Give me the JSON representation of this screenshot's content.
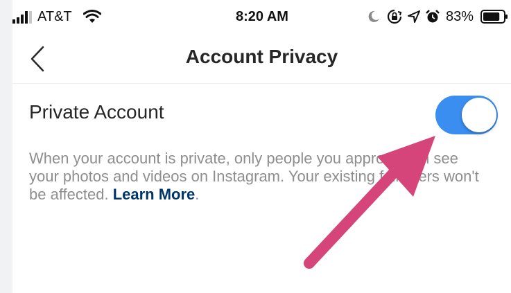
{
  "status_bar": {
    "carrier": "AT&T",
    "time": "8:20 AM",
    "battery_percent": "83%",
    "battery_level": 0.83,
    "icons": [
      "signal-icon",
      "wifi-icon",
      "moon-icon",
      "rotation-lock-icon",
      "location-icon",
      "alarm-icon",
      "battery-icon"
    ]
  },
  "nav": {
    "title": "Account Privacy",
    "back_icon": "chevron-left-icon"
  },
  "setting": {
    "label": "Private Account",
    "enabled": true,
    "toggle_color": "#3a8ef0"
  },
  "description": {
    "text": "When your account is private, only people you approve can see your photos and videos on Instagram. Your existing followers won't be affected.",
    "link_text": "Learn More",
    "trailing": ".",
    "link_color": "#003569"
  },
  "annotation": {
    "arrow_color": "#d6457a",
    "icon": "pointer-arrow-icon"
  }
}
